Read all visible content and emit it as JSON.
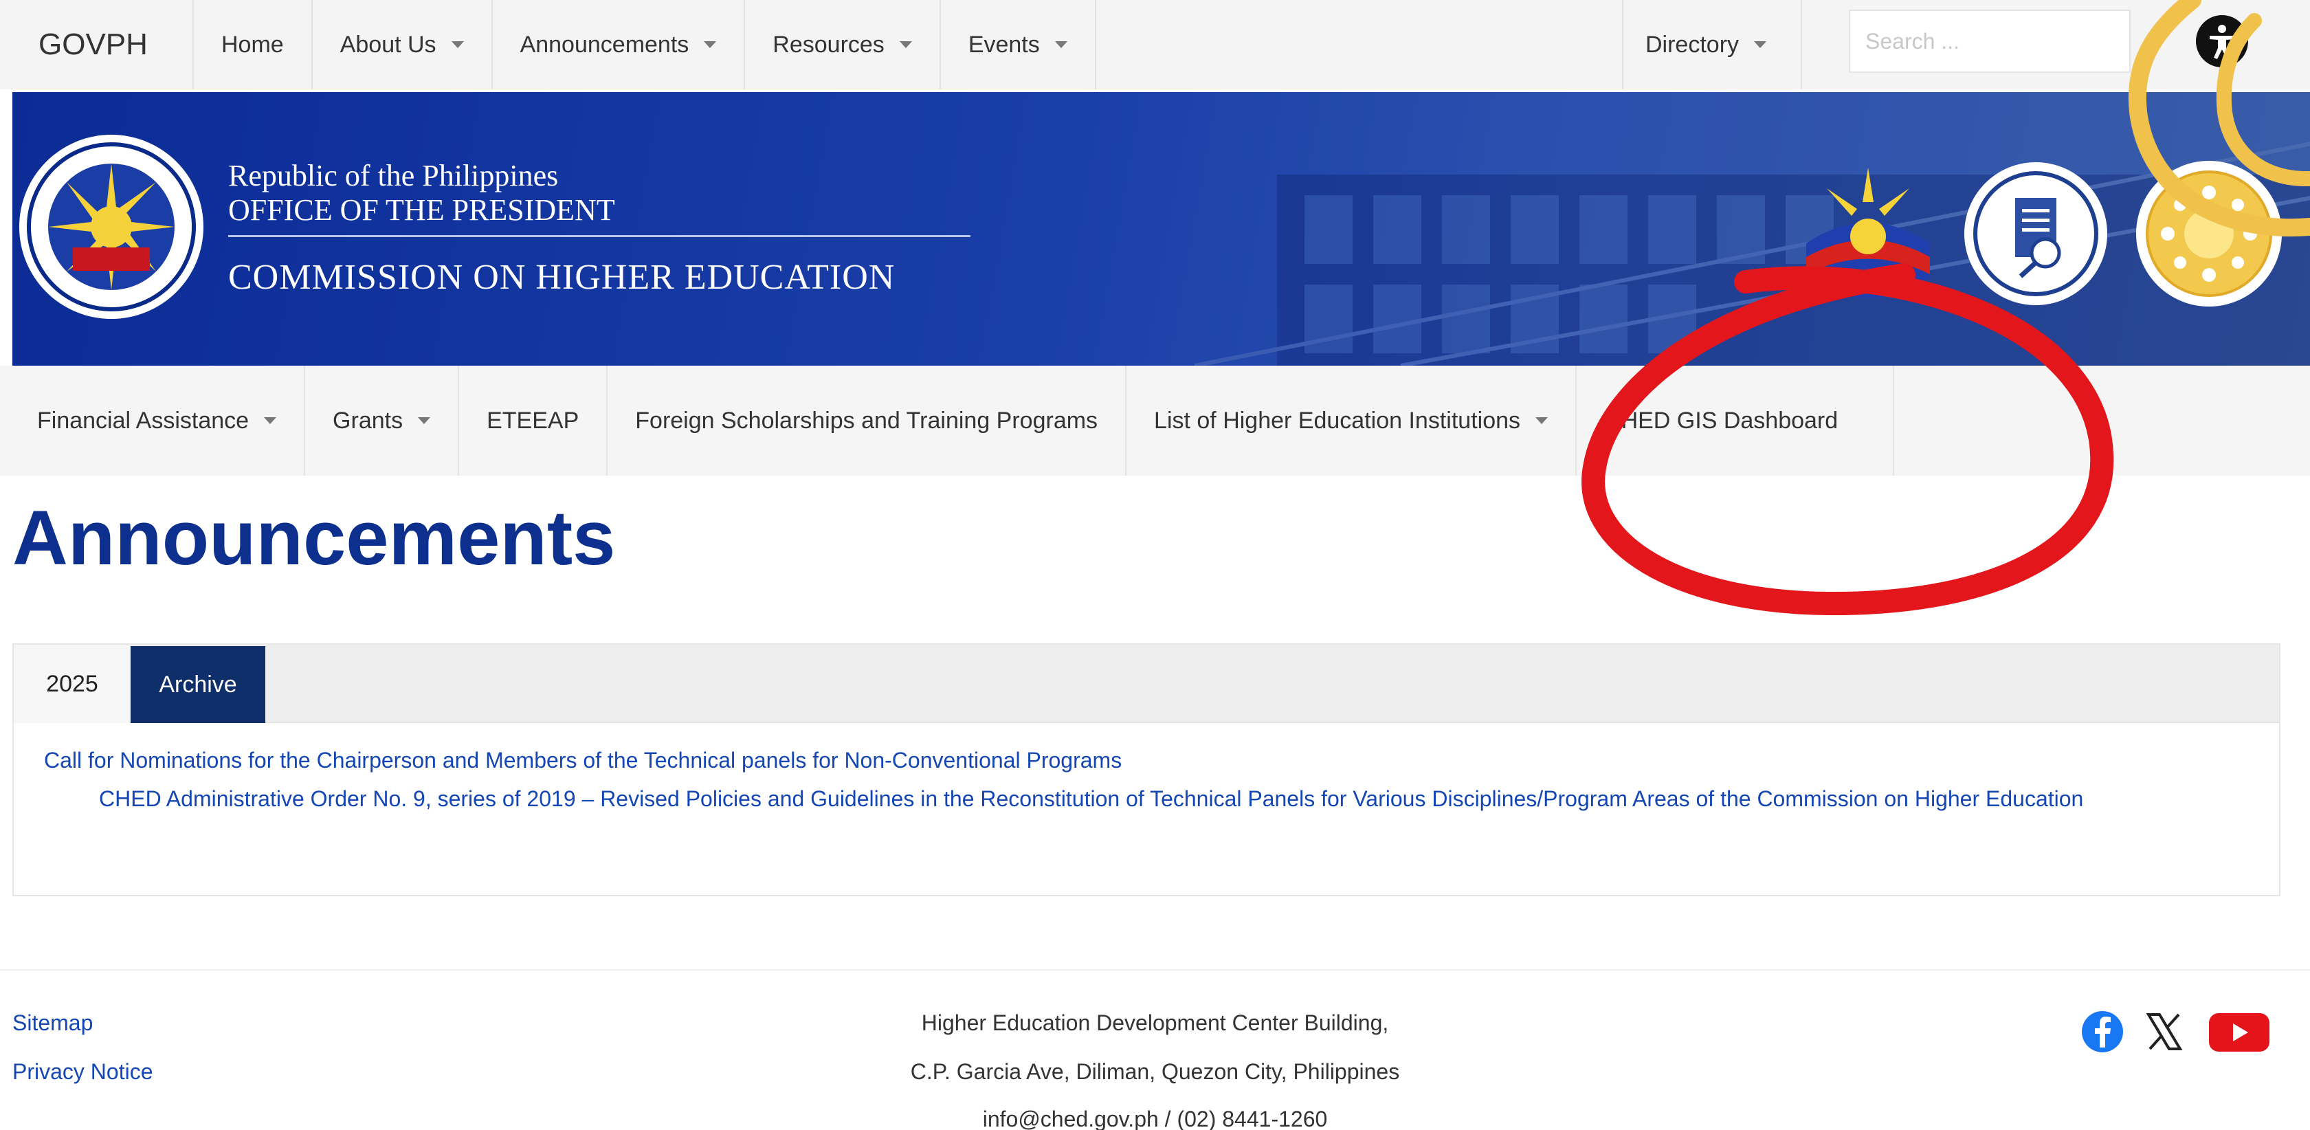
{
  "topbar": {
    "brand": "GOVPH",
    "nav": [
      {
        "label": "Home",
        "dropdown": false
      },
      {
        "label": "About Us",
        "dropdown": true
      },
      {
        "label": "Announcements",
        "dropdown": true
      },
      {
        "label": "Resources",
        "dropdown": true
      },
      {
        "label": "Events",
        "dropdown": true
      }
    ],
    "directory": "Directory",
    "search_placeholder": "Search ..."
  },
  "banner": {
    "line1": "Republic of the Philippines",
    "line2": "OFFICE OF THE PRESIDENT",
    "line3": "COMMISSION ON HIGHER EDUCATION"
  },
  "subnav": [
    {
      "label": "Financial Assistance",
      "dropdown": true
    },
    {
      "label": "Grants",
      "dropdown": true
    },
    {
      "label": "ETEEAP",
      "dropdown": false
    },
    {
      "label": "Foreign Scholarships and Training Programs",
      "dropdown": false
    },
    {
      "label": "List of Higher Education Institutions",
      "dropdown": true
    },
    {
      "label": "CHED GIS Dashboard",
      "dropdown": false
    }
  ],
  "page_title": "Announcements",
  "tabs": [
    {
      "label": "2025",
      "active": false
    },
    {
      "label": "Archive",
      "active": true
    }
  ],
  "announcements": [
    "Call for Nominations for the Chairperson and Members of the Technical panels for Non-Conventional Programs",
    "CHED Administrative Order No. 9, series of 2019 – Revised Policies and Guidelines in the Reconstitution of Technical Panels for Various Disciplines/Program Areas of the Commission on Higher Education"
  ],
  "footer": {
    "links": [
      "Sitemap",
      "Privacy Notice"
    ],
    "address": [
      "Higher Education Development Center Building,",
      "C.P. Garcia Ave, Diliman, Quezon City, Philippines",
      "info@ched.gov.ph / (02) 8441-1260"
    ],
    "social": [
      "facebook-icon",
      "x-icon",
      "youtube-icon"
    ]
  },
  "colors": {
    "banner_blue": "#0b2b95",
    "title_blue": "#0d2f8e",
    "link_blue": "#1446b4",
    "archive_tab": "#0f2f6a",
    "annotation_red": "#e3161b",
    "annotation_yellow": "#f0c14b"
  }
}
